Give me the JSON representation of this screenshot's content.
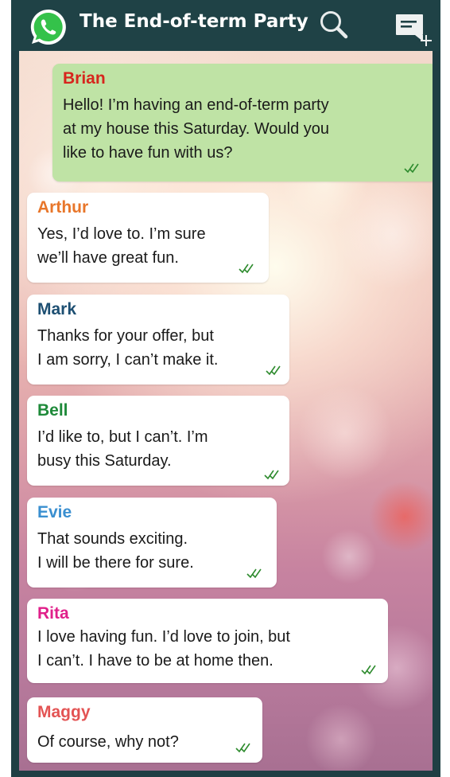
{
  "header": {
    "title": "The End-of-term Party",
    "icons": [
      "whatsapp-icon",
      "search-icon",
      "new-message-icon"
    ],
    "background_color": "#1f4246"
  },
  "messages": [
    {
      "sender": "Brian",
      "sender_color": "#d7261d",
      "own": true,
      "lines": [
        "Hello! I’m having an end-of-term party",
        "at my house this Saturday. Would you",
        "like to have fun with us?"
      ],
      "status": "double-tick-icon"
    },
    {
      "sender": "Arthur",
      "sender_color": "#e8762a",
      "own": false,
      "lines": [
        "Yes, I’d love to. I’m sure",
        "we’ll have great fun."
      ],
      "status": "double-tick-icon"
    },
    {
      "sender": "Mark",
      "sender_color": "#1d4f72",
      "own": false,
      "lines": [
        "Thanks for your offer, but",
        "I am sorry, I can’t make it."
      ],
      "status": "double-tick-icon"
    },
    {
      "sender": "Bell",
      "sender_color": "#1f8a3a",
      "own": false,
      "lines": [
        "I’d like to, but I can’t. I’m",
        "busy this Saturday."
      ],
      "status": "double-tick-icon"
    },
    {
      "sender": "Evie",
      "sender_color": "#3a8fd0",
      "own": false,
      "lines": [
        "That sounds exciting.",
        "I will be there for sure."
      ],
      "status": "double-tick-icon"
    },
    {
      "sender": "Rita",
      "sender_color": "#e0208a",
      "own": false,
      "lines": [
        "I love having fun. I’d love to join, but",
        "I can’t. I have to be at home then."
      ],
      "status": "double-tick-icon"
    },
    {
      "sender": "Maggy",
      "sender_color": "#e35353",
      "own": false,
      "lines": [
        "Of course, why not?"
      ],
      "status": "double-tick-icon"
    }
  ],
  "colors": {
    "own_bubble": "#bfe3a5",
    "other_bubble": "#ffffff",
    "tick_green": "#2e8b2e"
  }
}
